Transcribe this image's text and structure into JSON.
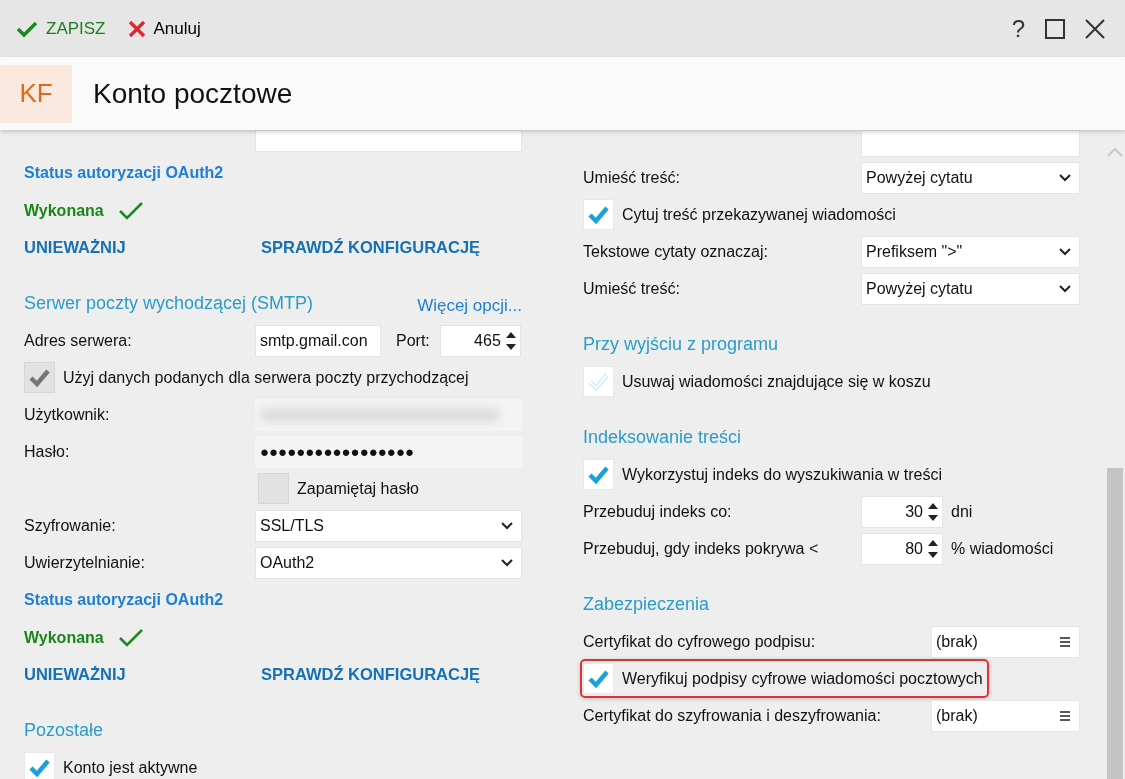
{
  "toolbar": {
    "save": "ZAPISZ",
    "cancel": "Anuluj",
    "help": "?"
  },
  "header": {
    "badge": "KF",
    "title": "Konto pocztowe"
  },
  "left": [
    {
      "kind": "cut"
    },
    {
      "kind": "heading_link",
      "text": "Status autoryzacji OAuth2"
    },
    {
      "kind": "status",
      "text": "Wykonana"
    },
    {
      "kind": "actions",
      "buttons": [
        "UNIEWAŻNIJ",
        "SPRAWDŹ KONFIGURACJĘ"
      ]
    },
    {
      "kind": "section",
      "title": "Serwer poczty wychodzącej (SMTP)",
      "link": "Więcej opcji..."
    },
    {
      "kind": "address",
      "label": "Adres serwera:",
      "value": "smtp.gmail.con",
      "port_label": "Port:",
      "port_value": "465"
    },
    {
      "kind": "checkbox",
      "label": "Użyj danych podanych dla serwera poczty przychodzącej",
      "checked": true,
      "disabled": true,
      "highlighted": false
    },
    {
      "kind": "blurred",
      "label": "Użytkownik:"
    },
    {
      "kind": "password",
      "label": "Hasło:",
      "value": "●●●●●●●●●●●●●●●●●"
    },
    {
      "kind": "field_checkbox",
      "label": "Zapamiętaj hasło",
      "checked": false,
      "disabled": true
    },
    {
      "kind": "select",
      "label": "Szyfrowanie:",
      "value": "SSL/TLS"
    },
    {
      "kind": "select",
      "label": "Uwierzytelnianie:",
      "value": "OAuth2"
    },
    {
      "kind": "heading_link",
      "text": "Status autoryzacji OAuth2"
    },
    {
      "kind": "status",
      "text": "Wykonana"
    },
    {
      "kind": "actions",
      "buttons": [
        "UNIEWAŻNIJ",
        "SPRAWDŹ KONFIGURACJĘ"
      ]
    },
    {
      "kind": "section",
      "title": "Pozostałe"
    },
    {
      "kind": "checkbox",
      "label": "Konto jest aktywne",
      "checked": true,
      "disabled": false,
      "highlighted": false
    }
  ],
  "right": [
    {
      "kind": "cut"
    },
    {
      "kind": "select",
      "label": "Umieść treść:",
      "value": "Powyżej cytatu"
    },
    {
      "kind": "checkbox",
      "label": "Cytuj treść przekazywanej wiadomości",
      "checked": true,
      "disabled": false,
      "highlighted": false
    },
    {
      "kind": "select",
      "label": "Tekstowe cytaty oznaczaj:",
      "value": "Prefiksem \">\""
    },
    {
      "kind": "select",
      "label": "Umieść treść:",
      "value": "Powyżej cytatu"
    },
    {
      "kind": "section",
      "title": "Przy wyjściu z programu"
    },
    {
      "kind": "checkbox",
      "label": "Usuwaj wiadomości znajdujące się w koszu",
      "checked": false,
      "disabled": false,
      "highlighted": false
    },
    {
      "kind": "section",
      "title": "Indeksowanie treści"
    },
    {
      "kind": "checkbox",
      "label": "Wykorzystuj indeks do wyszukiwania w treści",
      "checked": true,
      "disabled": false,
      "highlighted": false
    },
    {
      "kind": "spinner",
      "label": "Przebuduj indeks co:",
      "value": "30",
      "unit": "dni"
    },
    {
      "kind": "spinner",
      "label": "Przebuduj, gdy indeks pokrywa <",
      "value": "80",
      "unit": "% wiadomości"
    },
    {
      "kind": "section",
      "title": "Zabezpieczenia"
    },
    {
      "kind": "picker",
      "label": "Certyfikat do cyfrowego podpisu:",
      "value": "(brak)"
    },
    {
      "kind": "checkbox",
      "label": "Weryfikuj podpisy cyfrowe wiadomości pocztowych",
      "checked": true,
      "disabled": false,
      "highlighted": true
    },
    {
      "kind": "picker",
      "label": "Certyfikat do szyfrowania i deszyfrowania:",
      "value": "(brak)"
    }
  ]
}
